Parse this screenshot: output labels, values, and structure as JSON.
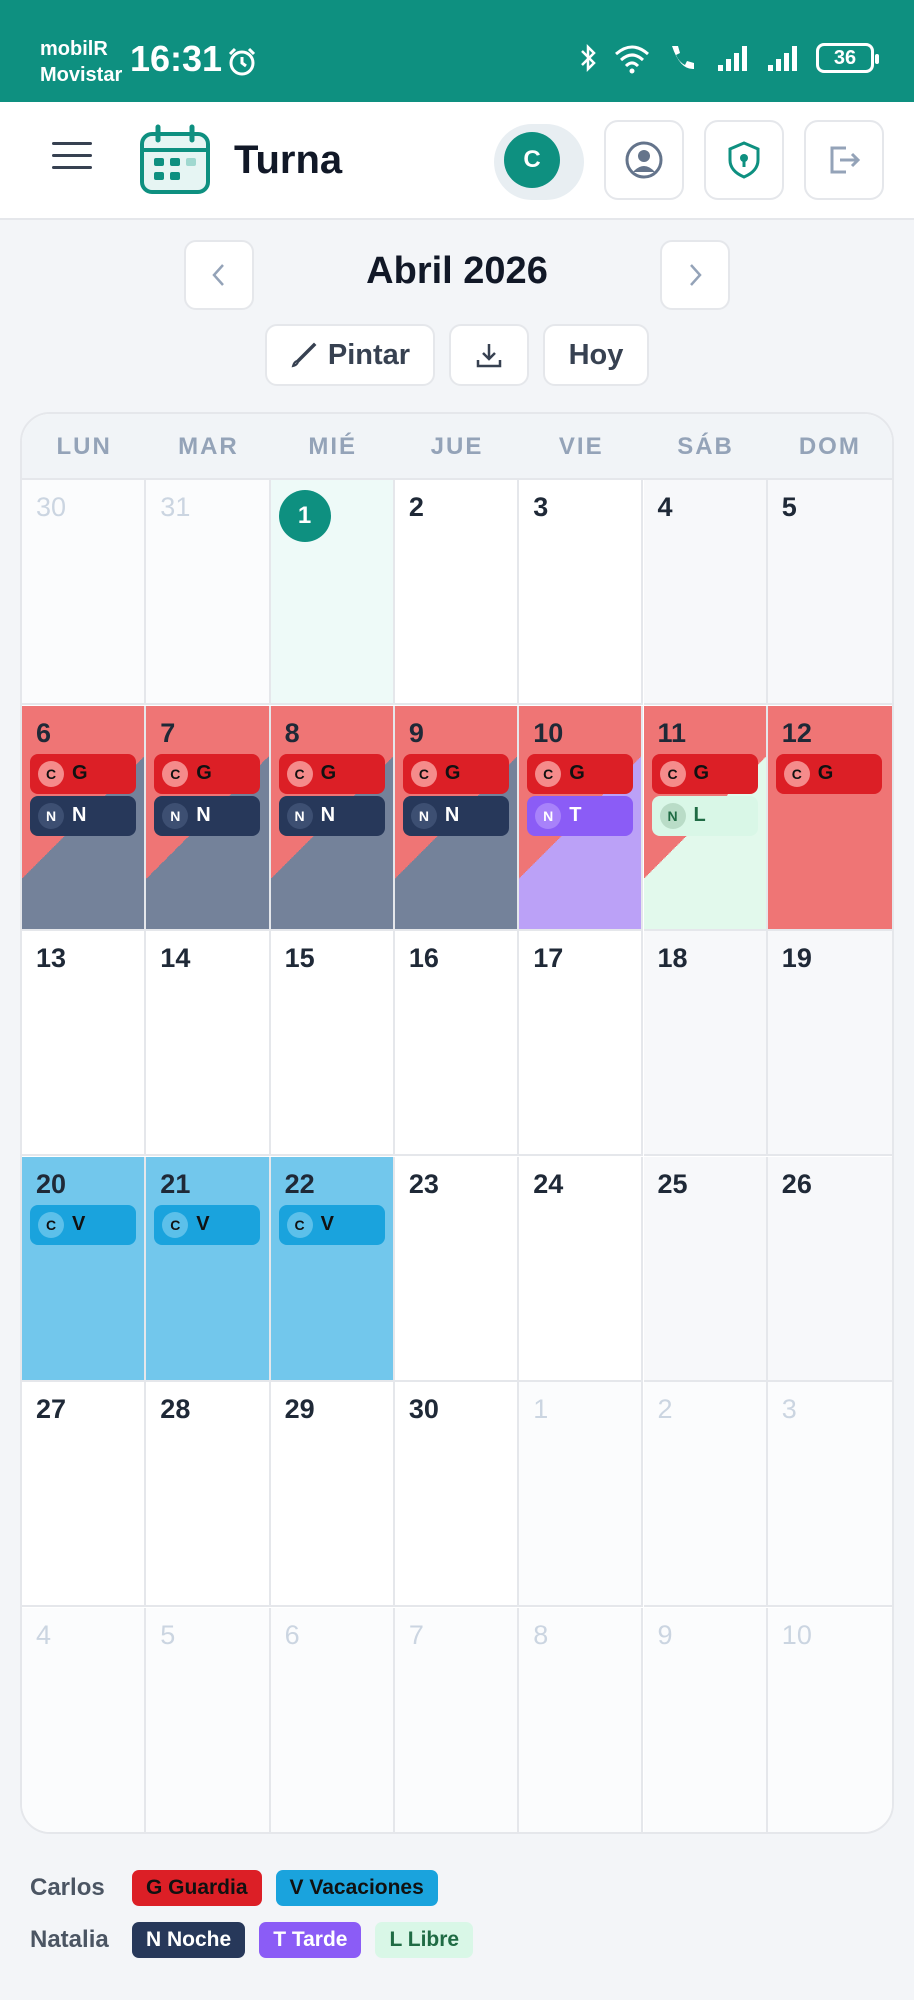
{
  "status_bar": {
    "carrier_line1": "mobilR",
    "carrier_line2": "Movistar",
    "time": "16:31",
    "battery": "36"
  },
  "header": {
    "app_title": "Turna",
    "avatar_initial": "C"
  },
  "month_nav": {
    "title": "Abril 2026",
    "paint_label": "Pintar",
    "today_label": "Hoy"
  },
  "weekdays": [
    "LUN",
    "MAR",
    "MIÉ",
    "JUE",
    "VIE",
    "SÁB",
    "DOM"
  ],
  "colors": {
    "teal": "#0e9080",
    "guardia": "#dc1f26",
    "guardia_bg": "#ef7575",
    "noche": "#27385a",
    "noche_bg": "#74829a",
    "tarde": "#8b5cf6",
    "tarde_bg": "#bba1f7",
    "libre": "#d9f7e7",
    "libre_bg": "#e2f9ec",
    "vacaciones": "#1aa3dd",
    "vacaciones_bg": "#72c7ec"
  },
  "calendar": {
    "weeks": [
      [
        {
          "day": "30",
          "other": true
        },
        {
          "day": "31",
          "other": true
        },
        {
          "day": "1",
          "today": true
        },
        {
          "day": "2"
        },
        {
          "day": "3"
        },
        {
          "day": "4",
          "weekend": true
        },
        {
          "day": "5",
          "weekend": true
        }
      ],
      [
        {
          "day": "6",
          "bg": [
            "guardia",
            "noche"
          ],
          "shifts": [
            {
              "person": "C",
              "code": "G",
              "type": "guardia"
            },
            {
              "person": "N",
              "code": "N",
              "type": "noche"
            }
          ]
        },
        {
          "day": "7",
          "bg": [
            "guardia",
            "noche"
          ],
          "shifts": [
            {
              "person": "C",
              "code": "G",
              "type": "guardia"
            },
            {
              "person": "N",
              "code": "N",
              "type": "noche"
            }
          ]
        },
        {
          "day": "8",
          "bg": [
            "guardia",
            "noche"
          ],
          "shifts": [
            {
              "person": "C",
              "code": "G",
              "type": "guardia"
            },
            {
              "person": "N",
              "code": "N",
              "type": "noche"
            }
          ]
        },
        {
          "day": "9",
          "bg": [
            "guardia",
            "noche"
          ],
          "shifts": [
            {
              "person": "C",
              "code": "G",
              "type": "guardia"
            },
            {
              "person": "N",
              "code": "N",
              "type": "noche"
            }
          ]
        },
        {
          "day": "10",
          "bg": [
            "guardia",
            "tarde"
          ],
          "shifts": [
            {
              "person": "C",
              "code": "G",
              "type": "guardia"
            },
            {
              "person": "N",
              "code": "T",
              "type": "tarde"
            }
          ]
        },
        {
          "day": "11",
          "bg": [
            "guardia",
            "libre"
          ],
          "shifts": [
            {
              "person": "C",
              "code": "G",
              "type": "guardia"
            },
            {
              "person": "N",
              "code": "L",
              "type": "libre"
            }
          ]
        },
        {
          "day": "12",
          "bg": [
            "guardia"
          ],
          "shifts": [
            {
              "person": "C",
              "code": "G",
              "type": "guardia"
            }
          ]
        }
      ],
      [
        {
          "day": "13"
        },
        {
          "day": "14"
        },
        {
          "day": "15"
        },
        {
          "day": "16"
        },
        {
          "day": "17"
        },
        {
          "day": "18",
          "weekend": true
        },
        {
          "day": "19",
          "weekend": true
        }
      ],
      [
        {
          "day": "20",
          "bg": [
            "vacaciones"
          ],
          "shifts": [
            {
              "person": "C",
              "code": "V",
              "type": "vacaciones"
            }
          ]
        },
        {
          "day": "21",
          "bg": [
            "vacaciones"
          ],
          "shifts": [
            {
              "person": "C",
              "code": "V",
              "type": "vacaciones"
            }
          ]
        },
        {
          "day": "22",
          "bg": [
            "vacaciones"
          ],
          "shifts": [
            {
              "person": "C",
              "code": "V",
              "type": "vacaciones"
            }
          ]
        },
        {
          "day": "23"
        },
        {
          "day": "24"
        },
        {
          "day": "25",
          "weekend": true
        },
        {
          "day": "26",
          "weekend": true
        }
      ],
      [
        {
          "day": "27"
        },
        {
          "day": "28"
        },
        {
          "day": "29"
        },
        {
          "day": "30"
        },
        {
          "day": "1",
          "other": true
        },
        {
          "day": "2",
          "other": true
        },
        {
          "day": "3",
          "other": true
        }
      ],
      [
        {
          "day": "4",
          "other": true
        },
        {
          "day": "5",
          "other": true
        },
        {
          "day": "6",
          "other": true
        },
        {
          "day": "7",
          "other": true
        },
        {
          "day": "8",
          "other": true
        },
        {
          "day": "9",
          "other": true
        },
        {
          "day": "10",
          "other": true
        }
      ]
    ]
  },
  "legend": [
    {
      "name": "Carlos",
      "items": [
        {
          "label": "G Guardia",
          "type": "guardia"
        },
        {
          "label": "V Vacaciones",
          "type": "vacaciones"
        }
      ]
    },
    {
      "name": "Natalia",
      "items": [
        {
          "label": "N Noche",
          "type": "noche"
        },
        {
          "label": "T Tarde",
          "type": "tarde"
        },
        {
          "label": "L Libre",
          "type": "libre"
        }
      ]
    }
  ]
}
